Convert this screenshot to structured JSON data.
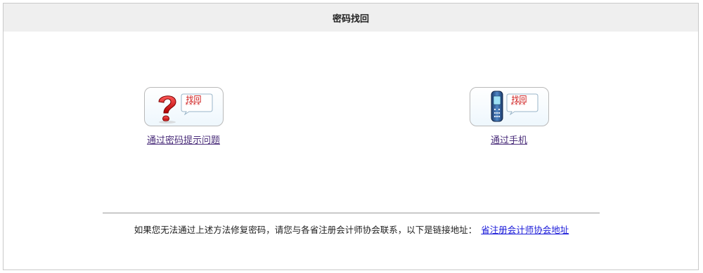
{
  "header": {
    "title": "密码找回"
  },
  "options": {
    "question": {
      "label": "通过密码提示问题",
      "icon": "question-mark-icon",
      "bubble_text": "找回",
      "bubble_stars": "****"
    },
    "mobile": {
      "label": "通过手机",
      "icon": "mobile-phone-icon",
      "bubble_text": "找回",
      "bubble_stars": "****"
    }
  },
  "footer": {
    "message": "如果您无法通过上述方法修复密码，请您与各省注册会计师协会联系，以下是链接地址：",
    "link_label": "省注册会计师协会地址"
  },
  "colors": {
    "header_bg": "#efefef",
    "option_link": "#4a2d7a",
    "footer_link": "#1b1bd9",
    "accent_red": "#cc1111"
  }
}
